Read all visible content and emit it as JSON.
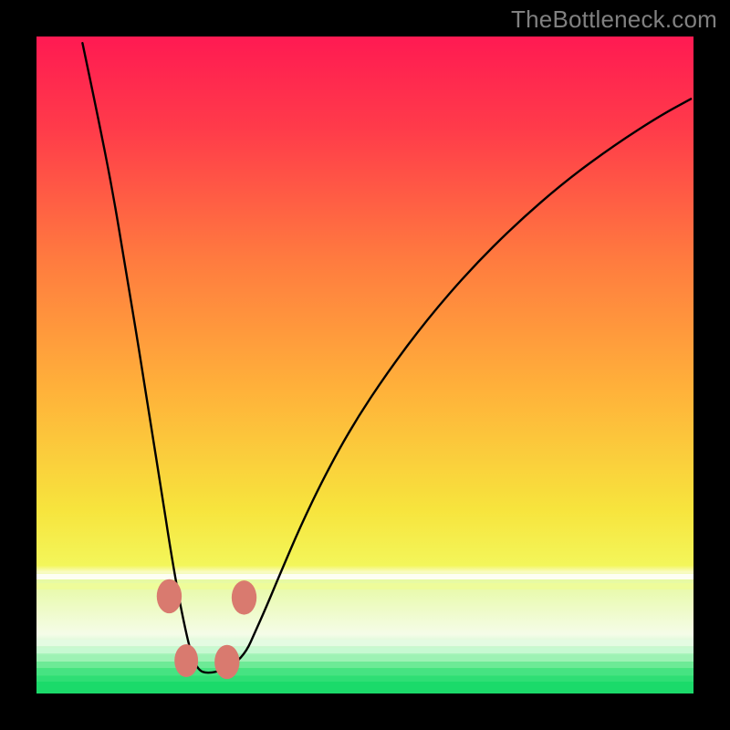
{
  "watermark": "TheBottleneck.com",
  "chart_data": {
    "type": "line",
    "title": "",
    "xlabel": "",
    "ylabel": "",
    "xlim": [
      0,
      100
    ],
    "ylim": [
      0,
      100
    ],
    "legend": false,
    "grid": false,
    "gradient_stops": [
      {
        "pct": 0,
        "color": "#ff1a52"
      },
      {
        "pct": 14,
        "color": "#ff3b4a"
      },
      {
        "pct": 34,
        "color": "#ff7b3f"
      },
      {
        "pct": 54,
        "color": "#ffb23a"
      },
      {
        "pct": 72,
        "color": "#f7e43d"
      },
      {
        "pct": 80.5,
        "color": "#f3f65a"
      },
      {
        "pct": 81.5,
        "color": "#f9fbc4"
      },
      {
        "pct": 82.6,
        "color": "#e6faa0"
      },
      {
        "pct": 91,
        "color": "#f5fce8"
      },
      {
        "pct": 93.5,
        "color": "#bdf7c8"
      },
      {
        "pct": 96.2,
        "color": "#48e57e"
      },
      {
        "pct": 100,
        "color": "#17da68"
      }
    ],
    "thin_bars": [
      {
        "pct_top": 81.8,
        "pct_h": 0.9,
        "color": "#fdfef3"
      },
      {
        "pct_top": 83.2,
        "pct_h": 1.0,
        "color": "#eefc9a"
      },
      {
        "pct_top": 91.8,
        "pct_h": 1.0,
        "color": "#e4fbe2"
      },
      {
        "pct_top": 93.0,
        "pct_h": 0.9,
        "color": "#c7f9d2"
      },
      {
        "pct_top": 94.2,
        "pct_h": 0.9,
        "color": "#9df2b4"
      },
      {
        "pct_top": 95.2,
        "pct_h": 0.9,
        "color": "#6dea96"
      },
      {
        "pct_top": 96.3,
        "pct_h": 0.9,
        "color": "#46e382"
      },
      {
        "pct_top": 97.3,
        "pct_h": 0.9,
        "color": "#2fde75"
      },
      {
        "pct_top": 98.2,
        "pct_h": 1.8,
        "color": "#1bda6a"
      }
    ],
    "series": [
      {
        "name": "curve",
        "color": "#000000",
        "width": 2.4,
        "x": [
          7,
          9.2,
          11.5,
          13.5,
          15.5,
          17.3,
          19.0,
          20.3,
          21.5,
          22.5,
          23.3,
          24.0,
          24.8,
          25.8,
          27.6,
          30.2,
          32.0,
          33.2,
          34.9,
          37.2,
          40.2,
          43.8,
          48.2,
          53.5,
          59.5,
          66.0,
          73.0,
          80.5,
          88.0,
          95.0,
          99.6
        ],
        "y": [
          99.0,
          88.5,
          77.0,
          65.0,
          53.0,
          41.5,
          31.0,
          22.5,
          15.5,
          10.5,
          7.0,
          4.8,
          3.5,
          3.1,
          3.3,
          4.5,
          6.5,
          9.2,
          13.0,
          18.5,
          25.5,
          33.0,
          41.0,
          49.0,
          57.0,
          64.5,
          71.5,
          78.0,
          83.5,
          88.0,
          90.5
        ]
      }
    ],
    "markers": [
      {
        "x": 20.2,
        "y": 14.8,
        "rx": 1.9,
        "ry": 2.6,
        "color": "#d97a6f"
      },
      {
        "x": 22.8,
        "y": 5.0,
        "rx": 1.8,
        "ry": 2.5,
        "color": "#d97a6f"
      },
      {
        "x": 29.0,
        "y": 4.8,
        "rx": 1.9,
        "ry": 2.6,
        "color": "#d97a6f"
      },
      {
        "x": 31.6,
        "y": 14.6,
        "rx": 1.9,
        "ry": 2.6,
        "color": "#d97a6f"
      }
    ]
  }
}
